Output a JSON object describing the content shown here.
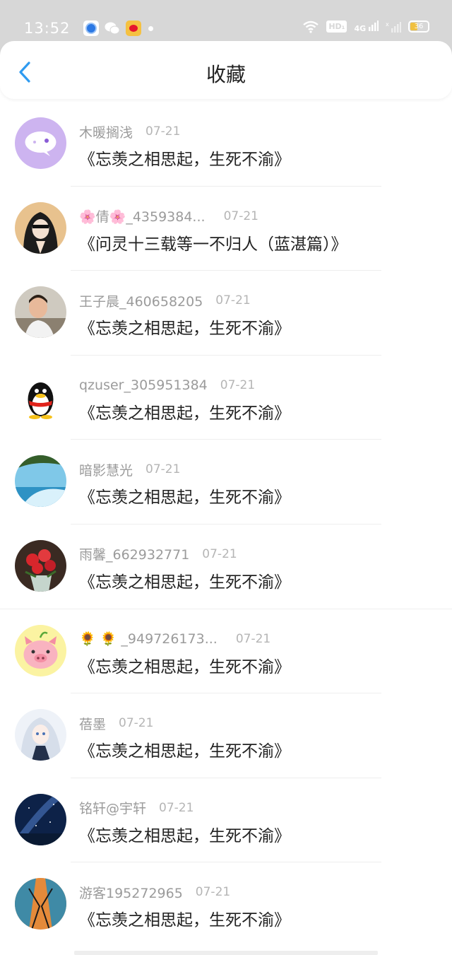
{
  "status_bar": {
    "time": "13:52",
    "battery": "36",
    "hd": "HD₁",
    "network": "4G"
  },
  "header": {
    "title": "收藏"
  },
  "colors": {
    "accent": "#2f9bf0",
    "divider": "#eeeeee",
    "status_bg": "#d7d7d7"
  },
  "items": [
    {
      "name": "木暖搁浅",
      "date": "07-21",
      "title": "《忘羡之相思起，生死不渝》"
    },
    {
      "name": "🌸倩🌸_4359384...",
      "date": "07-21",
      "title": "《问灵十三载等一不归人（蓝湛篇）》"
    },
    {
      "name": "王子晨_460658205",
      "date": "07-21",
      "title": "《忘羡之相思起，生死不渝》"
    },
    {
      "name": "qzuser_305951384",
      "date": "07-21",
      "title": "《忘羡之相思起，生死不渝》"
    },
    {
      "name": "暗影慧光",
      "date": "07-21",
      "title": "《忘羡之相思起，生死不渝》"
    },
    {
      "name": "雨馨_662932771",
      "date": "07-21",
      "title": "《忘羡之相思起，生死不渝》"
    },
    {
      "name": "🌻 🌻 _949726173...",
      "date": "07-21",
      "title": "《忘羡之相思起，生死不渝》"
    },
    {
      "name": "蓓墨",
      "date": "07-21",
      "title": "《忘羡之相思起，生死不渝》"
    },
    {
      "name": "铭轩@宇轩",
      "date": "07-21",
      "title": "《忘羡之相思起，生死不渝》"
    },
    {
      "name": "游客195272965",
      "date": "07-21",
      "title": "《忘羡之相思起，生死不渝》"
    }
  ]
}
